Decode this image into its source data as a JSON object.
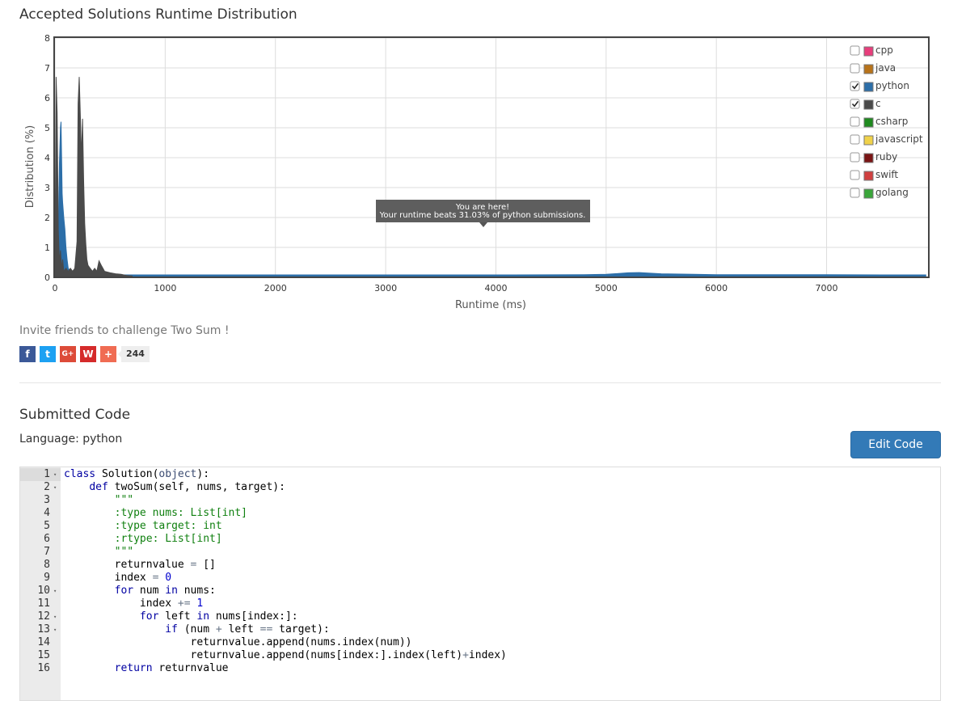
{
  "page": {
    "title": "Accepted Solutions Runtime Distribution",
    "invite": "Invite friends to challenge Two Sum !",
    "share_count": "244",
    "submitted_title": "Submitted Code",
    "language_line": "Language: python",
    "edit_button": "Edit Code"
  },
  "tooltip": {
    "line1": "You are here!",
    "line2": "Your runtime beats 31.03% of python submissions."
  },
  "share_buttons": [
    {
      "name": "facebook-icon",
      "glyph": "f",
      "color": "#3b5998"
    },
    {
      "name": "twitter-icon",
      "glyph": "t",
      "color": "#1da1f2"
    },
    {
      "name": "google-plus-icon",
      "glyph": "G+",
      "color": "#dd4b39"
    },
    {
      "name": "weibo-icon",
      "glyph": "W",
      "color": "#d52b2b"
    },
    {
      "name": "add-more-icon",
      "glyph": "+",
      "color": "#f06c53"
    }
  ],
  "chart_data": {
    "type": "area",
    "title": "Accepted Solutions Runtime Distribution",
    "xlabel": "Runtime (ms)",
    "ylabel": "Distribution (%)",
    "xlim": [
      0,
      7920
    ],
    "ylim": [
      0,
      8
    ],
    "xticks": [
      0,
      1000,
      2000,
      3000,
      4000,
      5000,
      6000,
      7000
    ],
    "yticks": [
      0,
      1,
      2,
      3,
      4,
      5,
      6,
      7,
      8
    ],
    "grid": true,
    "legend_position": "top-right",
    "legend": [
      {
        "name": "cpp",
        "color": "#e83e7c",
        "checked": false
      },
      {
        "name": "java",
        "color": "#b8731a",
        "checked": false
      },
      {
        "name": "python",
        "color": "#2c6ea8",
        "checked": true
      },
      {
        "name": "c",
        "color": "#4a4a4a",
        "checked": true
      },
      {
        "name": "csharp",
        "color": "#1f8a1f",
        "checked": false
      },
      {
        "name": "javascript",
        "color": "#f0d24a",
        "checked": false
      },
      {
        "name": "ruby",
        "color": "#7a1515",
        "checked": false
      },
      {
        "name": "swift",
        "color": "#d04040",
        "checked": false
      },
      {
        "name": "golang",
        "color": "#3aa63a",
        "checked": false
      }
    ],
    "series": [
      {
        "name": "c",
        "x": [
          0,
          10,
          20,
          30,
          40,
          50,
          60,
          70,
          80,
          100,
          120,
          140,
          160,
          180,
          200,
          210,
          220,
          230,
          240,
          250,
          260,
          270,
          280,
          290,
          300,
          320,
          340,
          360,
          380,
          400,
          420,
          450,
          500,
          550,
          600,
          650,
          700
        ],
        "y": [
          0.4,
          6.7,
          5.5,
          1.6,
          0.5,
          0.9,
          0.3,
          0.6,
          0.2,
          0.3,
          0.2,
          0.3,
          0.2,
          0.3,
          1.2,
          5.8,
          6.7,
          5.4,
          4.0,
          5.3,
          3.2,
          1.8,
          1.1,
          0.6,
          0.4,
          0.3,
          0.2,
          0.3,
          0.2,
          0.55,
          0.4,
          0.2,
          0.15,
          0.12,
          0.1,
          0.06,
          0.04
        ]
      },
      {
        "name": "python",
        "x": [
          30,
          40,
          50,
          55,
          60,
          65,
          70,
          80,
          90,
          100,
          110,
          120,
          140,
          160,
          200,
          300,
          400,
          500,
          600,
          800,
          1000,
          1500,
          2000,
          3000,
          4000,
          4800,
          5000,
          5200,
          5300,
          5500,
          5800,
          6000,
          6500,
          7000,
          7500,
          7900
        ],
        "y": [
          1.2,
          3.8,
          5.0,
          5.2,
          4.0,
          2.8,
          2.5,
          2.0,
          1.6,
          1.0,
          0.6,
          0.3,
          0.2,
          0.15,
          0.1,
          0.08,
          0.08,
          0.08,
          0.08,
          0.08,
          0.08,
          0.08,
          0.08,
          0.08,
          0.08,
          0.09,
          0.1,
          0.15,
          0.16,
          0.12,
          0.1,
          0.09,
          0.09,
          0.09,
          0.08,
          0.08
        ]
      }
    ]
  },
  "code_lines": [
    [
      {
        "t": "class",
        "c": "kw"
      },
      {
        "t": " Solution("
      },
      {
        "t": "object",
        "c": "bi"
      },
      {
        "t": "):"
      }
    ],
    [
      {
        "t": "    "
      },
      {
        "t": "def",
        "c": "kw"
      },
      {
        "t": " twoSum(self, nums, target):"
      }
    ],
    [
      {
        "t": "        "
      },
      {
        "t": "\"\"\"",
        "c": "str"
      }
    ],
    [
      {
        "t": "        "
      },
      {
        "t": ":type nums: List[int]",
        "c": "str"
      }
    ],
    [
      {
        "t": "        "
      },
      {
        "t": ":type target: int",
        "c": "str"
      }
    ],
    [
      {
        "t": "        "
      },
      {
        "t": ":rtype: List[int]",
        "c": "str"
      }
    ],
    [
      {
        "t": "        "
      },
      {
        "t": "\"\"\"",
        "c": "str"
      }
    ],
    [
      {
        "t": "        returnvalue "
      },
      {
        "t": "=",
        "c": "op"
      },
      {
        "t": " []"
      }
    ],
    [
      {
        "t": "        index "
      },
      {
        "t": "=",
        "c": "op"
      },
      {
        "t": " "
      },
      {
        "t": "0",
        "c": "num"
      }
    ],
    [
      {
        "t": "        "
      },
      {
        "t": "for",
        "c": "kw"
      },
      {
        "t": " num "
      },
      {
        "t": "in",
        "c": "kw"
      },
      {
        "t": " nums:"
      }
    ],
    [
      {
        "t": "            index "
      },
      {
        "t": "+=",
        "c": "op"
      },
      {
        "t": " "
      },
      {
        "t": "1",
        "c": "num"
      }
    ],
    [
      {
        "t": "            "
      },
      {
        "t": "for",
        "c": "kw"
      },
      {
        "t": " left "
      },
      {
        "t": "in",
        "c": "kw"
      },
      {
        "t": " nums[index:]:"
      }
    ],
    [
      {
        "t": "                "
      },
      {
        "t": "if",
        "c": "kw"
      },
      {
        "t": " (num "
      },
      {
        "t": "+",
        "c": "op"
      },
      {
        "t": " left "
      },
      {
        "t": "==",
        "c": "op"
      },
      {
        "t": " target):"
      }
    ],
    [
      {
        "t": "                    returnvalue.append(nums.index(num))"
      }
    ],
    [
      {
        "t": "                    returnvalue.append(nums[index:].index(left)"
      },
      {
        "t": "+",
        "c": "op"
      },
      {
        "t": "index)"
      }
    ],
    [
      {
        "t": "        "
      },
      {
        "t": "return",
        "c": "kw"
      },
      {
        "t": " returnvalue"
      }
    ]
  ],
  "line_numbers": [
    "1",
    "2",
    "3",
    "4",
    "5",
    "6",
    "7",
    "8",
    "9",
    "10",
    "11",
    "12",
    "13",
    "14",
    "15",
    "16"
  ],
  "fold_lines": [
    1,
    2,
    10,
    12,
    13
  ]
}
